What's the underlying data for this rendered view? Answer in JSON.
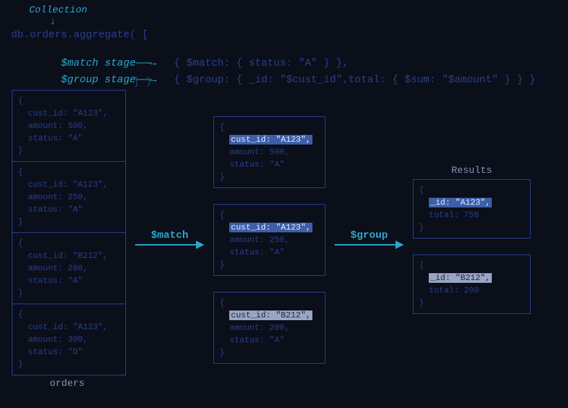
{
  "header": {
    "collection_label": "Collection",
    "code_main": "db.orders.aggregate( [",
    "match_label": "$match stage",
    "group_label": "$group stage",
    "arrow": "———→",
    "match_code": "{ $match: { status: \"A\" } },",
    "group_code": "{ $group: { _id: \"$cust_id\",total: { $sum: \"$amount\" } } }",
    "close": "] )"
  },
  "orders_label": "orders",
  "results_label": "Results",
  "op_match": "$match",
  "op_group": "$group",
  "col1": [
    {
      "cust_id": "A123",
      "amount": 500,
      "status": "A"
    },
    {
      "cust_id": "A123",
      "amount": 250,
      "status": "A"
    },
    {
      "cust_id": "B212",
      "amount": 200,
      "status": "A"
    },
    {
      "cust_id": "A123",
      "amount": 300,
      "status": "D"
    }
  ],
  "col2": [
    {
      "cust_id": "A123",
      "amount": 500,
      "status": "A",
      "hl": "blue"
    },
    {
      "cust_id": "A123",
      "amount": 250,
      "status": "A",
      "hl": "blue"
    },
    {
      "cust_id": "B212",
      "amount": 200,
      "status": "A",
      "hl": "grey"
    }
  ],
  "col3": [
    {
      "_id": "A123",
      "total": 750,
      "hl": "blue"
    },
    {
      "_id": "B212",
      "total": 200,
      "hl": "grey"
    }
  ]
}
